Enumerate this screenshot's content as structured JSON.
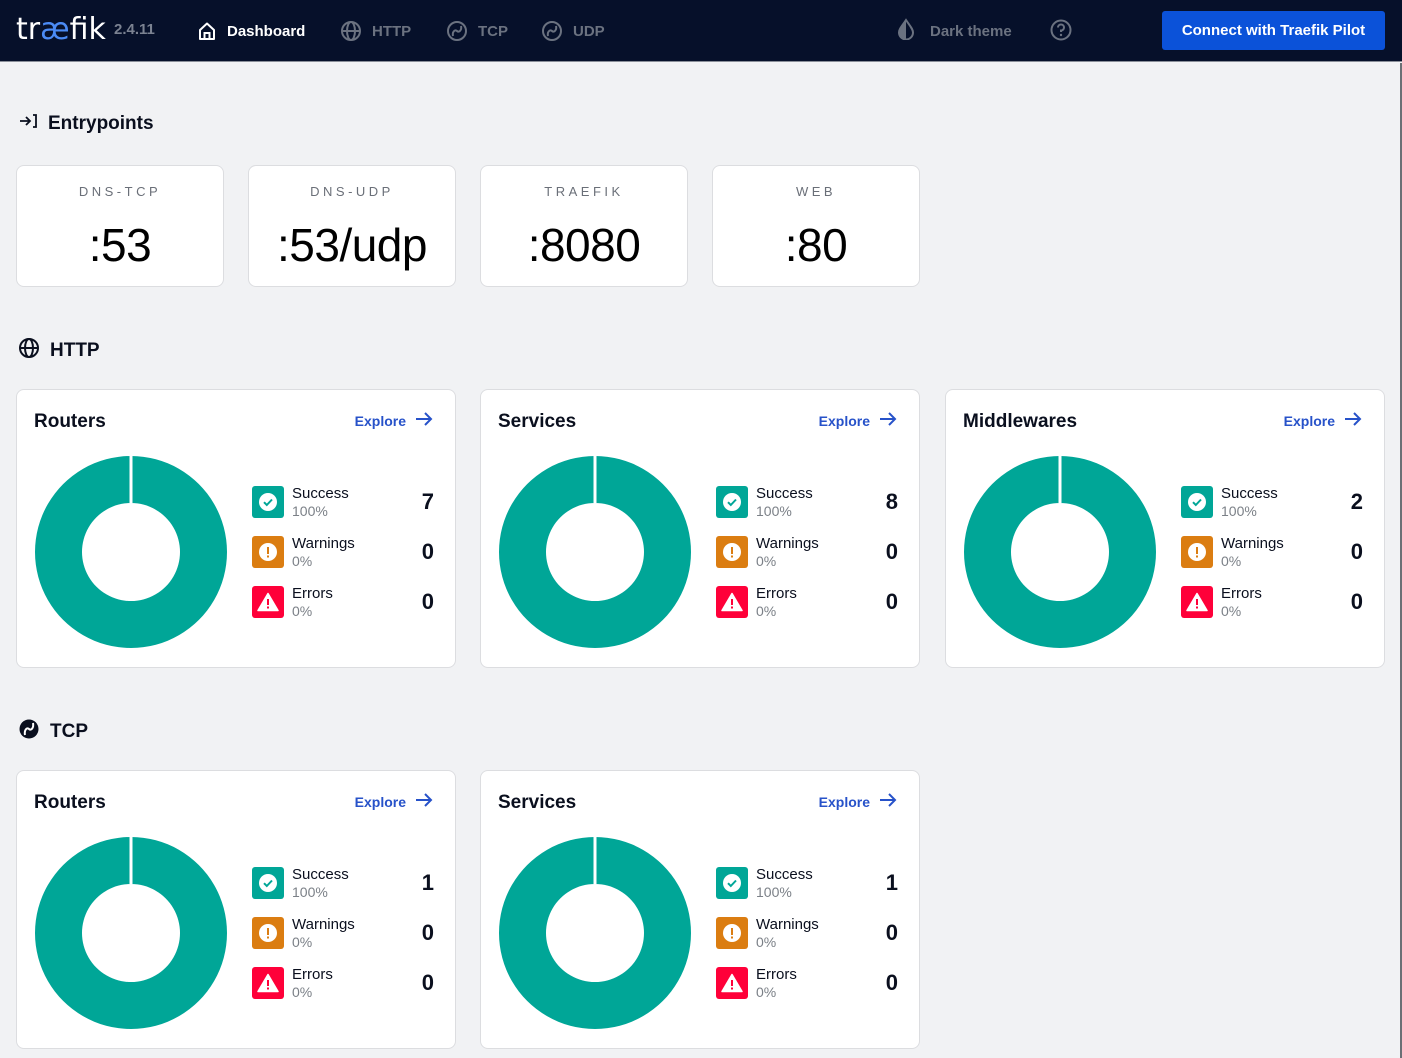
{
  "header": {
    "logo_pre": "tr",
    "logo_ae": "æ",
    "logo_post": "fik",
    "version": "2.4.11",
    "nav": [
      {
        "label": "Dashboard",
        "icon": "home-icon",
        "active": true
      },
      {
        "label": "HTTP",
        "icon": "globe-icon",
        "active": false
      },
      {
        "label": "TCP",
        "icon": "tcp-icon",
        "active": false
      },
      {
        "label": "UDP",
        "icon": "udp-icon",
        "active": false
      }
    ],
    "theme_toggle": "Dark theme",
    "help_icon": "question-circle-icon",
    "pilot_button": "Connect with Traefik Pilot"
  },
  "entrypoints": {
    "title": "Entrypoints",
    "items": [
      {
        "name": "DNS-TCP",
        "port": ":53"
      },
      {
        "name": "DNS-UDP",
        "port": ":53/udp"
      },
      {
        "name": "TRAEFIK",
        "port": ":8080"
      },
      {
        "name": "WEB",
        "port": ":80"
      }
    ]
  },
  "http": {
    "title": "HTTP",
    "cards": [
      {
        "title": "Routers",
        "explore": "Explore",
        "stats": [
          {
            "label": "Success",
            "percent": "100%",
            "count": "7"
          },
          {
            "label": "Warnings",
            "percent": "0%",
            "count": "0"
          },
          {
            "label": "Errors",
            "percent": "0%",
            "count": "0"
          }
        ]
      },
      {
        "title": "Services",
        "explore": "Explore",
        "stats": [
          {
            "label": "Success",
            "percent": "100%",
            "count": "8"
          },
          {
            "label": "Warnings",
            "percent": "0%",
            "count": "0"
          },
          {
            "label": "Errors",
            "percent": "0%",
            "count": "0"
          }
        ]
      },
      {
        "title": "Middlewares",
        "explore": "Explore",
        "stats": [
          {
            "label": "Success",
            "percent": "100%",
            "count": "2"
          },
          {
            "label": "Warnings",
            "percent": "0%",
            "count": "0"
          },
          {
            "label": "Errors",
            "percent": "0%",
            "count": "0"
          }
        ]
      }
    ]
  },
  "tcp": {
    "title": "TCP",
    "cards": [
      {
        "title": "Routers",
        "explore": "Explore",
        "stats": [
          {
            "label": "Success",
            "percent": "100%",
            "count": "1"
          },
          {
            "label": "Warnings",
            "percent": "0%",
            "count": "0"
          },
          {
            "label": "Errors",
            "percent": "0%",
            "count": "0"
          }
        ]
      },
      {
        "title": "Services",
        "explore": "Explore",
        "stats": [
          {
            "label": "Success",
            "percent": "100%",
            "count": "1"
          },
          {
            "label": "Warnings",
            "percent": "0%",
            "count": "0"
          },
          {
            "label": "Errors",
            "percent": "0%",
            "count": "0"
          }
        ]
      }
    ]
  },
  "colors": {
    "success": "#00a697",
    "warning": "#db7d11",
    "error": "#ff0039",
    "accent": "#0b52d9",
    "link": "#2752c9",
    "topbar": "#06102a"
  }
}
